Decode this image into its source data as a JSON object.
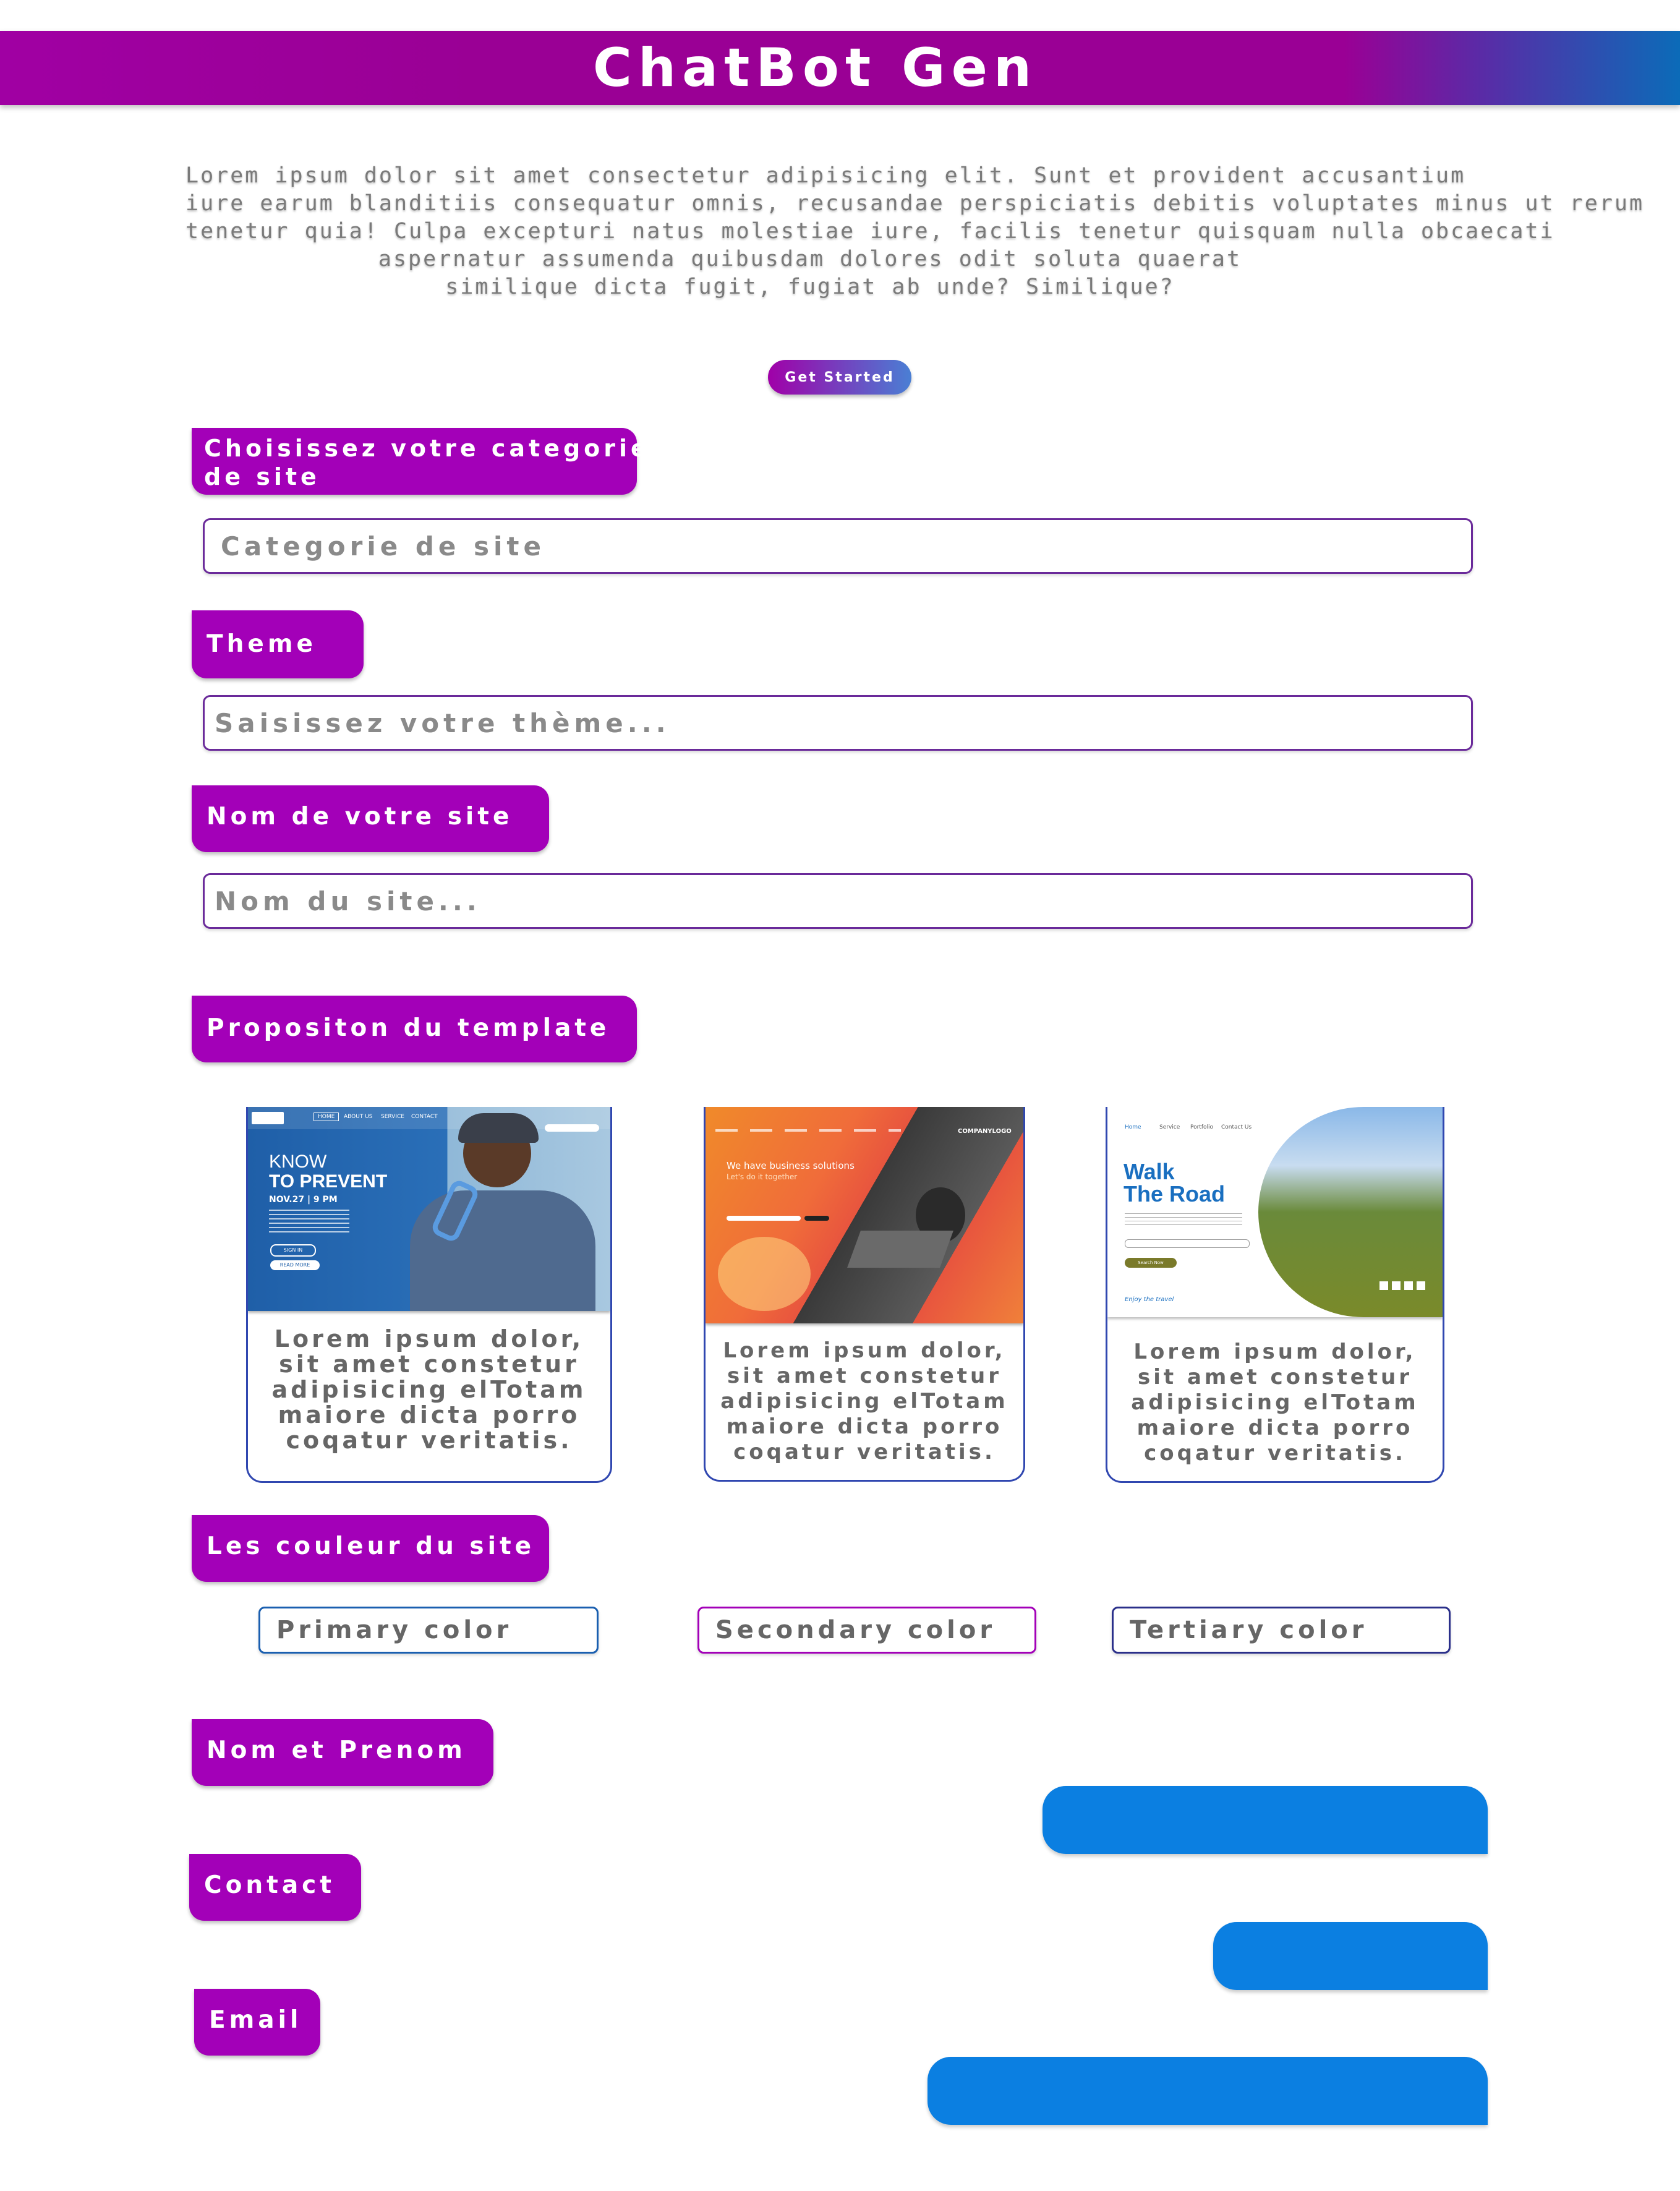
{
  "header": {
    "title": "ChatBot Gen"
  },
  "intro": {
    "lines": [
      "Lorem ipsum dolor sit amet consectetur adipisicing elit. Sunt et provident accusantium",
      "iure earum blanditiis consequatur omnis, recusandae perspiciatis debitis voluptates minus ut rerum",
      "tenetur quia! Culpa excepturi natus molestiae iure, facilis tenetur quisquam nulla obcaecati",
      "aspernatur assumenda quibusdam dolores odit soluta quaerat",
      "similique dicta fugit, fugiat ab unde? Similique?"
    ]
  },
  "get_started": {
    "label": "Get Started"
  },
  "category": {
    "label_line1": "Choisissez votre categorie",
    "label_line2": "de site",
    "placeholder": "Categorie de site"
  },
  "theme": {
    "label": "Theme",
    "placeholder": "Saisissez votre thème..."
  },
  "site_name": {
    "label": "Nom de votre site",
    "placeholder": "Nom du site..."
  },
  "templates": {
    "label": "Propositon du template",
    "cards": [
      {
        "text": [
          "Lorem ipsum dolor,",
          "sit amet constetur",
          "adipisicing elTotam",
          "maiore dicta porro",
          "coqatur veritatis."
        ],
        "thumb": {
          "nav": [
            "HOME",
            "ABOUT US",
            "SERVICE",
            "CONTACT"
          ],
          "heading1": "KNOW",
          "heading2": "TO PREVENT",
          "date": "NOV.27 | 9 PM",
          "button1": "SIGN IN",
          "button2": "READ MORE"
        }
      },
      {
        "text": [
          "Lorem ipsum dolor,",
          "sit amet constetur",
          "adipisicing elTotam",
          "maiore dicta porro",
          "coqatur veritatis."
        ],
        "thumb": {
          "brand": "COMPANYLOGO",
          "heading": "We have business solutions",
          "sub": "Let's do it together"
        }
      },
      {
        "text": [
          "Lorem ipsum dolor,",
          "sit amet constetur",
          "adipisicing elTotam",
          "maiore dicta porro",
          "coqatur veritatis."
        ],
        "thumb": {
          "nav": [
            "Home",
            "Service",
            "Portfolio",
            "Contact Us"
          ],
          "heading1": "Walk",
          "heading2": "The Road",
          "button": "Search Now",
          "footer": "Enjoy the travel"
        }
      }
    ]
  },
  "colors": {
    "label": "Les couleur du site",
    "primary": "Primary color",
    "secondary": "Secondary color",
    "tertiary": "Tertiary color",
    "primary_border": "#1a5fb0",
    "secondary_border": "#a300b8",
    "tertiary_border": "#2a2f8a"
  },
  "nom_prenom": {
    "label": "Nom et Prenom"
  },
  "contact": {
    "label": "Contact"
  },
  "email": {
    "label": "Email"
  },
  "accent": {
    "purple": "#a300b8",
    "blue": "#0b7fe1"
  }
}
